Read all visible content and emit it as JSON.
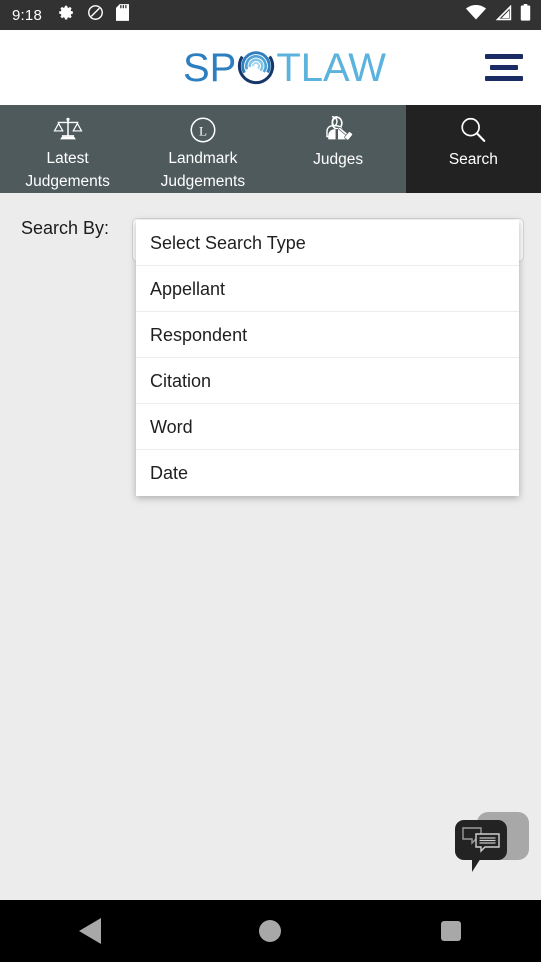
{
  "statusbar": {
    "time": "9:18",
    "left_icons": [
      "gear-icon",
      "do-not-disturb-icon",
      "sd-card-icon"
    ],
    "right_icons": [
      "wifi-icon",
      "cell-signal-icon",
      "battery-icon"
    ],
    "background": "#323232"
  },
  "header": {
    "logo_part1": "SP",
    "logo_mark": "swirl-globe-icon",
    "logo_part2": "TLAW",
    "logo_color_1": "#2e7fc0",
    "logo_color_2": "#5bb3dd",
    "menu_label": "hamburger-menu-icon",
    "menu_color": "#1b2b63"
  },
  "tabs": [
    {
      "label": "Latest\nJudgements",
      "icon": "scales-of-justice-icon",
      "active": false
    },
    {
      "label": "Landmark\nJudgements",
      "icon": "landmark-l-circle-icon",
      "active": false
    },
    {
      "label": "Judges",
      "icon": "judge-gavel-icon",
      "active": false
    },
    {
      "label": "Search",
      "icon": "magnifier-icon",
      "active": true
    }
  ],
  "tab_colors": {
    "inactive_bg": "#4e5a5c",
    "active_bg": "#222222",
    "text": "#ffffff"
  },
  "main": {
    "search_by_label": "Search By:",
    "select_value": "Select Search Type",
    "dropdown_open": true,
    "dropdown_options": [
      "Select Search Type",
      "Appellant",
      "Respondent",
      "Citation",
      "Word",
      "Date"
    ],
    "background": "#ececec"
  },
  "chat_widget": {
    "icon": "chat-bubbles-icon",
    "front_color": "#232323",
    "back_color": "#a8a8a8"
  },
  "navbar": {
    "back": "back-triangle-icon",
    "home": "home-circle-icon",
    "recents": "recents-square-icon",
    "icon_color": "#a8a8a8"
  }
}
